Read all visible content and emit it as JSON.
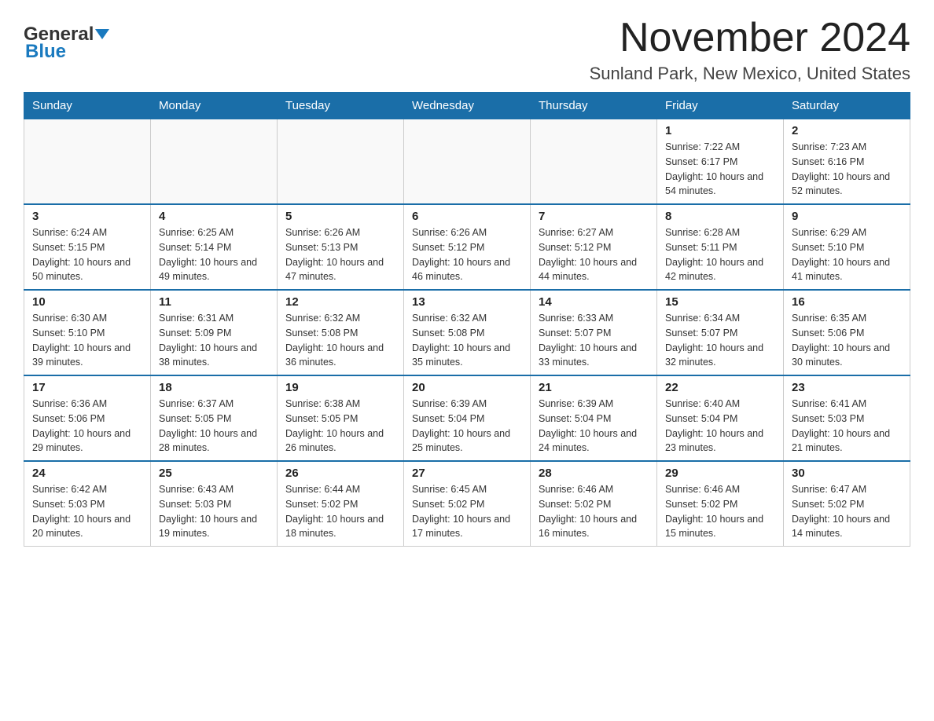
{
  "header": {
    "logo_general": "General",
    "logo_blue": "Blue",
    "month_title": "November 2024",
    "location": "Sunland Park, New Mexico, United States"
  },
  "days_of_week": [
    "Sunday",
    "Monday",
    "Tuesday",
    "Wednesday",
    "Thursday",
    "Friday",
    "Saturday"
  ],
  "weeks": [
    [
      {
        "day": "",
        "info": ""
      },
      {
        "day": "",
        "info": ""
      },
      {
        "day": "",
        "info": ""
      },
      {
        "day": "",
        "info": ""
      },
      {
        "day": "",
        "info": ""
      },
      {
        "day": "1",
        "info": "Sunrise: 7:22 AM\nSunset: 6:17 PM\nDaylight: 10 hours and 54 minutes."
      },
      {
        "day": "2",
        "info": "Sunrise: 7:23 AM\nSunset: 6:16 PM\nDaylight: 10 hours and 52 minutes."
      }
    ],
    [
      {
        "day": "3",
        "info": "Sunrise: 6:24 AM\nSunset: 5:15 PM\nDaylight: 10 hours and 50 minutes."
      },
      {
        "day": "4",
        "info": "Sunrise: 6:25 AM\nSunset: 5:14 PM\nDaylight: 10 hours and 49 minutes."
      },
      {
        "day": "5",
        "info": "Sunrise: 6:26 AM\nSunset: 5:13 PM\nDaylight: 10 hours and 47 minutes."
      },
      {
        "day": "6",
        "info": "Sunrise: 6:26 AM\nSunset: 5:12 PM\nDaylight: 10 hours and 46 minutes."
      },
      {
        "day": "7",
        "info": "Sunrise: 6:27 AM\nSunset: 5:12 PM\nDaylight: 10 hours and 44 minutes."
      },
      {
        "day": "8",
        "info": "Sunrise: 6:28 AM\nSunset: 5:11 PM\nDaylight: 10 hours and 42 minutes."
      },
      {
        "day": "9",
        "info": "Sunrise: 6:29 AM\nSunset: 5:10 PM\nDaylight: 10 hours and 41 minutes."
      }
    ],
    [
      {
        "day": "10",
        "info": "Sunrise: 6:30 AM\nSunset: 5:10 PM\nDaylight: 10 hours and 39 minutes."
      },
      {
        "day": "11",
        "info": "Sunrise: 6:31 AM\nSunset: 5:09 PM\nDaylight: 10 hours and 38 minutes."
      },
      {
        "day": "12",
        "info": "Sunrise: 6:32 AM\nSunset: 5:08 PM\nDaylight: 10 hours and 36 minutes."
      },
      {
        "day": "13",
        "info": "Sunrise: 6:32 AM\nSunset: 5:08 PM\nDaylight: 10 hours and 35 minutes."
      },
      {
        "day": "14",
        "info": "Sunrise: 6:33 AM\nSunset: 5:07 PM\nDaylight: 10 hours and 33 minutes."
      },
      {
        "day": "15",
        "info": "Sunrise: 6:34 AM\nSunset: 5:07 PM\nDaylight: 10 hours and 32 minutes."
      },
      {
        "day": "16",
        "info": "Sunrise: 6:35 AM\nSunset: 5:06 PM\nDaylight: 10 hours and 30 minutes."
      }
    ],
    [
      {
        "day": "17",
        "info": "Sunrise: 6:36 AM\nSunset: 5:06 PM\nDaylight: 10 hours and 29 minutes."
      },
      {
        "day": "18",
        "info": "Sunrise: 6:37 AM\nSunset: 5:05 PM\nDaylight: 10 hours and 28 minutes."
      },
      {
        "day": "19",
        "info": "Sunrise: 6:38 AM\nSunset: 5:05 PM\nDaylight: 10 hours and 26 minutes."
      },
      {
        "day": "20",
        "info": "Sunrise: 6:39 AM\nSunset: 5:04 PM\nDaylight: 10 hours and 25 minutes."
      },
      {
        "day": "21",
        "info": "Sunrise: 6:39 AM\nSunset: 5:04 PM\nDaylight: 10 hours and 24 minutes."
      },
      {
        "day": "22",
        "info": "Sunrise: 6:40 AM\nSunset: 5:04 PM\nDaylight: 10 hours and 23 minutes."
      },
      {
        "day": "23",
        "info": "Sunrise: 6:41 AM\nSunset: 5:03 PM\nDaylight: 10 hours and 21 minutes."
      }
    ],
    [
      {
        "day": "24",
        "info": "Sunrise: 6:42 AM\nSunset: 5:03 PM\nDaylight: 10 hours and 20 minutes."
      },
      {
        "day": "25",
        "info": "Sunrise: 6:43 AM\nSunset: 5:03 PM\nDaylight: 10 hours and 19 minutes."
      },
      {
        "day": "26",
        "info": "Sunrise: 6:44 AM\nSunset: 5:02 PM\nDaylight: 10 hours and 18 minutes."
      },
      {
        "day": "27",
        "info": "Sunrise: 6:45 AM\nSunset: 5:02 PM\nDaylight: 10 hours and 17 minutes."
      },
      {
        "day": "28",
        "info": "Sunrise: 6:46 AM\nSunset: 5:02 PM\nDaylight: 10 hours and 16 minutes."
      },
      {
        "day": "29",
        "info": "Sunrise: 6:46 AM\nSunset: 5:02 PM\nDaylight: 10 hours and 15 minutes."
      },
      {
        "day": "30",
        "info": "Sunrise: 6:47 AM\nSunset: 5:02 PM\nDaylight: 10 hours and 14 minutes."
      }
    ]
  ]
}
